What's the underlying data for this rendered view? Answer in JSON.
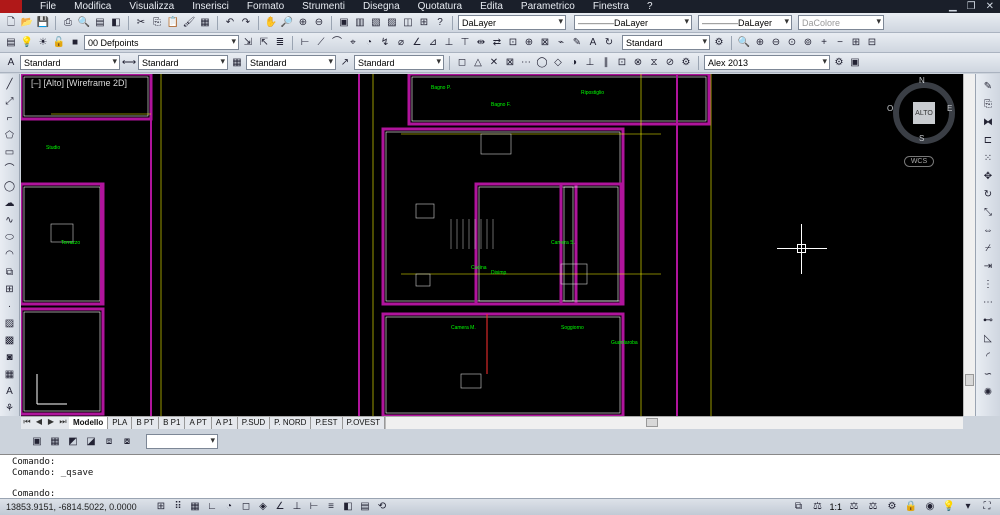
{
  "menu": [
    "File",
    "Modifica",
    "Visualizza",
    "Inserisci",
    "Formato",
    "Strumenti",
    "Disegna",
    "Quotatura",
    "Edita",
    "Parametrico",
    "Finestra",
    "?"
  ],
  "toolbar1": {
    "layer_current": "DaLayer",
    "linetype": "DaLayer",
    "lineweight": "DaLayer",
    "color": "DaColore"
  },
  "toolbar2": {
    "layer_dropdown": "00 Defpoints",
    "dimstyle": "Standard"
  },
  "toolbar3": {
    "textstyle": "Standard",
    "dimstyle2": "Standard",
    "tablestyle": "Standard",
    "mleaderstyle": "Standard",
    "user_dropdown": "Alex 2013"
  },
  "viewport": {
    "label": "[–] [Alto] [Wireframe 2D]",
    "cube_face": "ALTO",
    "north": "N",
    "south": "S",
    "east": "E",
    "west": "O",
    "wcs": "WCS"
  },
  "layout_tabs": [
    "Modello",
    "PLA",
    "B PT",
    "B P1",
    "A PT",
    "A P1",
    "P.SUD",
    "P. NORD",
    "P.EST",
    "P.OVEST"
  ],
  "active_tab": "Modello",
  "command_lines": [
    "Comando:",
    "Comando: _qsave"
  ],
  "command_prompt": "Comando:",
  "status": {
    "coords": "13853.9151, -6814.5022, 0.0000",
    "scale": "1:1"
  },
  "plan_labels": [
    "Bagno P.",
    "Bagno F.",
    "Studio",
    "Terrazzo",
    "Camera S.",
    "Camera M.",
    "Soggiorno",
    "Cucina",
    "Ripostiglio",
    "Disimp.",
    "Guardaroba"
  ],
  "colors": {
    "walls": "#b0149c",
    "walls_outer": "#ffffff",
    "dims": "#ffff00",
    "text": "#00ff00",
    "fixtures": "#d0d0d0",
    "axis": "#ff3030"
  }
}
